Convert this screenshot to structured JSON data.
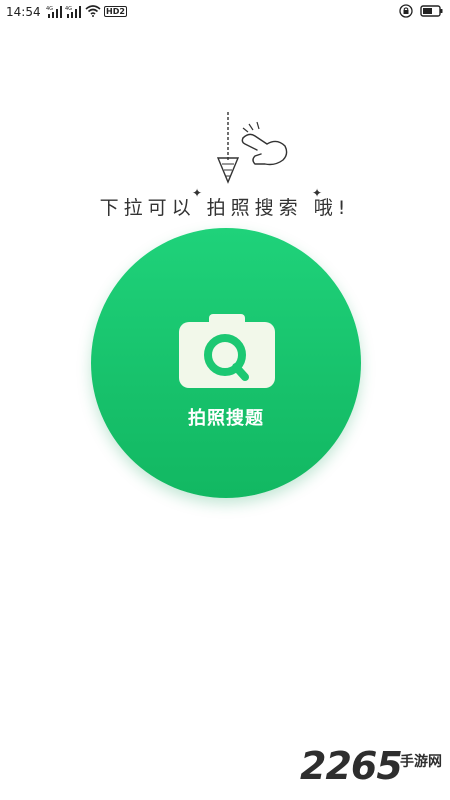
{
  "status_bar": {
    "time": "14:54",
    "network_badge": "HD2",
    "icons": [
      "signal-icon",
      "signal-icon",
      "wifi-icon",
      "hd-icon",
      "lock-rotation-icon",
      "battery-icon"
    ]
  },
  "hint": {
    "text": "下拉可以 拍照搜索 哦!",
    "illustration": "pull-down-gesture-icon"
  },
  "search_button": {
    "label": "拍照搜题",
    "icon": "camera-search-icon",
    "color": "#1cc872"
  },
  "watermark": {
    "number": "2265",
    "text": "手游网"
  },
  "colors": {
    "accent": "#1cc872",
    "background": "#ffffff"
  }
}
